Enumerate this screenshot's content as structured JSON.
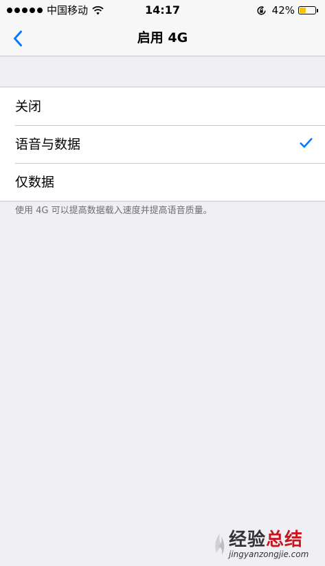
{
  "status_bar": {
    "carrier": "中国移动",
    "time": "14:17",
    "battery_percent": "42%",
    "battery_level": 0.42,
    "signal_dots": 5,
    "icons": [
      "signal-dots-icon",
      "wifi-icon",
      "rotation-lock-icon",
      "battery-icon"
    ]
  },
  "nav": {
    "title": "启用 4G",
    "back_icon": "chevron-left-icon"
  },
  "options": [
    {
      "label": "关闭",
      "selected": false
    },
    {
      "label": "语音与数据",
      "selected": true
    },
    {
      "label": "仅数据",
      "selected": false
    }
  ],
  "footer": {
    "note": "使用 4G 可以提高数据载入速度并提高语音质量。"
  },
  "watermark": {
    "main_text_1": "经验",
    "main_text_2": "总结",
    "url": "jingyanzongjie.com"
  },
  "colors": {
    "accent": "#007aff",
    "background": "#efeff4",
    "separator": "#c8c7cc",
    "battery_fill": "#f6c600",
    "footer_text": "#6d6d72",
    "watermark_red": "#c7161e"
  }
}
